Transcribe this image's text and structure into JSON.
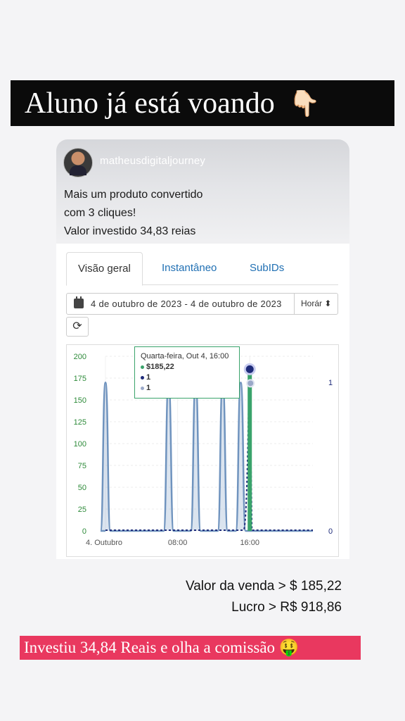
{
  "headline": {
    "text": "Aluno já está voando",
    "emoji": "👇🏻"
  },
  "post": {
    "username": "matheusdigitaljourney",
    "caption": [
      "Mais um produto convertido",
      "com 3 cliques!",
      "Valor investido 34,83 reias"
    ]
  },
  "tabs": [
    {
      "label": "Visão geral",
      "active": true
    },
    {
      "label": "Instantâneo",
      "active": false
    },
    {
      "label": "SubIDs",
      "active": false
    }
  ],
  "date_range": "4 de outubro de 2023 - 4 de outubro de 2023",
  "granularity": "Horár",
  "tooltip": {
    "title": "Quarta-feira, Out 4, 16:00",
    "rows": [
      {
        "value": "$185,22",
        "color": "#3aa36b"
      },
      {
        "value": "1",
        "color": "#1f2c7a"
      },
      {
        "value": "1",
        "color": "#9aa8c8"
      }
    ]
  },
  "chart_data": {
    "type": "area",
    "y_left_ticks": [
      "0",
      "25",
      "50",
      "75",
      "100",
      "125",
      "150",
      "175",
      "200"
    ],
    "y_right_ticks": [
      "0",
      "1"
    ],
    "x_ticks": [
      "4. Outubro",
      "08:00",
      "16:00"
    ],
    "ylim": [
      0,
      200
    ],
    "x": [
      0,
      1,
      2,
      3,
      4,
      5,
      6,
      7,
      8,
      9,
      10,
      11,
      12,
      13,
      14,
      15,
      16,
      17,
      18,
      19,
      20,
      21,
      22,
      23
    ],
    "series": [
      {
        "values": [
          170,
          0,
          0,
          0,
          0,
          0,
          0,
          170,
          0,
          0,
          170,
          0,
          0,
          170,
          0,
          170,
          0,
          0,
          0,
          0,
          0,
          0,
          0,
          0
        ],
        "color": "#6f93be"
      },
      {
        "values": [
          0,
          0,
          0,
          0,
          0,
          0,
          0,
          0,
          0,
          0,
          0,
          0,
          0,
          0,
          0,
          0,
          185.22,
          0,
          0,
          0,
          0,
          0,
          0,
          0
        ],
        "color": "#3aa36b"
      },
      {
        "values": [
          0,
          0,
          0,
          0,
          0,
          0,
          0,
          0,
          0,
          0,
          0,
          0,
          0,
          0,
          0,
          0,
          1,
          0,
          0,
          0,
          0,
          0,
          0,
          0
        ],
        "color": "#1f2c7a"
      }
    ]
  },
  "sales": {
    "line1": "Valor da venda > $ 185,22",
    "line2": "Lucro > R$ 918,86"
  },
  "banner": {
    "text": "Investiu 34,84 Reais e olha a comissão",
    "emoji": "🤑"
  }
}
